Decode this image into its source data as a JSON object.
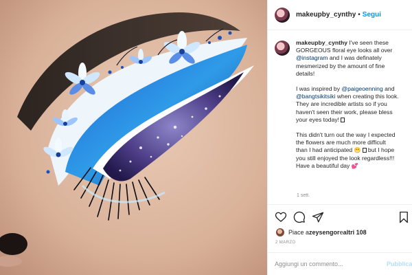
{
  "colors": {
    "link": "#0095f6",
    "hashtag": "#00376b",
    "muted": "#8e8e8e",
    "text": "#262626",
    "publish_disabled": "#b2dffc",
    "divider": "#efefef"
  },
  "photo": {
    "subject": "close-up of eye with blue floral eyeliner makeup"
  },
  "header": {
    "username": "makeupby_cynthy",
    "separator": "•",
    "follow_label": "Segui"
  },
  "caption": {
    "username": "makeupby_cynthy",
    "p1": {
      "text_a": " I've seen these",
      "line2": "GORGEOUS floral eye looks all over",
      "tag": "@instagram",
      "text_b": " and I was definately",
      "line4": "mesmerized by the amount of fine",
      "line5": "details!"
    },
    "p2": {
      "line1_a": "I was inspired by ",
      "tag1": "@paigeoenning",
      "line1_b": " and",
      "tag2": "@bangtsikitsiki",
      "line2_b": " when creating this look.",
      "line3": "They are incredible artists so if you",
      "line4": "haven't seen their work, please bless",
      "line5": "your eyes today!"
    },
    "p3": {
      "line1": "This didn't turn out the way I expected",
      "line2": "the flowers are much more difficult",
      "line3_a": "than I had anticipated ",
      "emoji1": "😬",
      "line3_b": " but I hope",
      "line4": "you still enjoyed the look regardless!!!",
      "line5_a": "Have a beautiful day ",
      "emoji2": "💕"
    },
    "age": "1 sett."
  },
  "actions": {
    "icons": [
      "heart-icon",
      "comment-icon",
      "share-icon",
      "bookmark-icon"
    ]
  },
  "likes": {
    "prefix": "Piace a ",
    "user": "zeysengor",
    "middle": " e ",
    "others": "altri 108"
  },
  "date": "2 MARZO",
  "comment": {
    "placeholder": "Aggiungi un commento...",
    "publish_label": "Pubblica"
  }
}
